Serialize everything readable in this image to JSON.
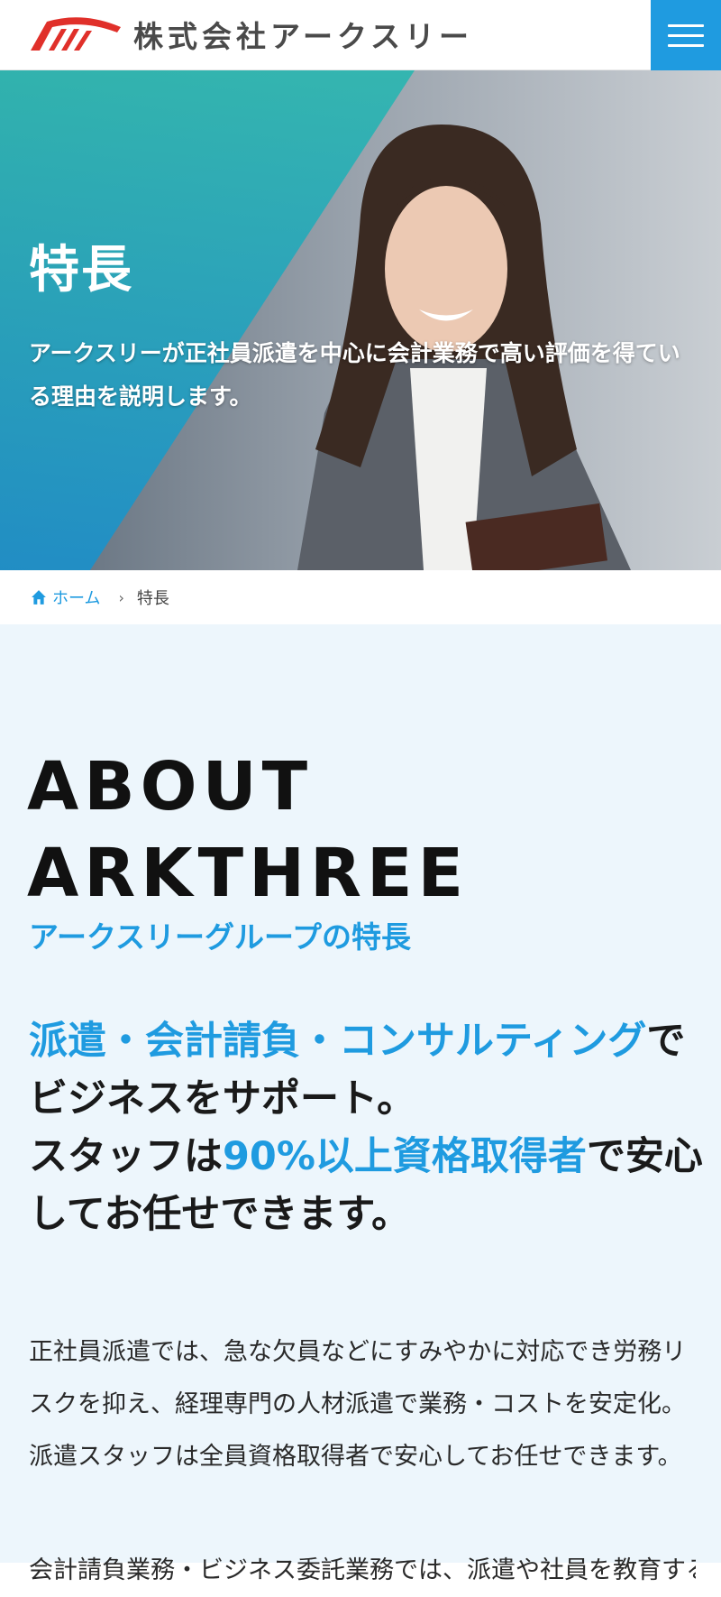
{
  "header": {
    "company_name": "株式会社アークスリー",
    "brand_color": "#1f9be0",
    "logo_color": "#e0302a"
  },
  "hero": {
    "title": "特長",
    "description": "アークスリーが正社員派遣を中心に会計業務で高い評価を得ている理由を説明します。"
  },
  "breadcrumb": {
    "home": "ホーム",
    "separator": "›",
    "current": "特長"
  },
  "about": {
    "heading_line1": "ABOUT",
    "heading_line2": "ARKTHREE",
    "subheading": "アークスリーグループの特長",
    "lead": {
      "part1": "派遣・会計請負・コンサルティング",
      "part2": "でビジネスをサポート。",
      "part3": "スタッフは",
      "part4": "90%以上資格取得者",
      "part5": "で安心してお任せできます。"
    },
    "body": "正社員派遣では、急な欠員などにすみやかに対応でき労務リスクを抑え、経理専門の人材派遣で業務・コストを安定化。派遣スタッフは全員資格取得者で安心してお任せできます。",
    "body2": "会計請負業務・ビジネス委託業務では、派遣や社員を教育する"
  }
}
